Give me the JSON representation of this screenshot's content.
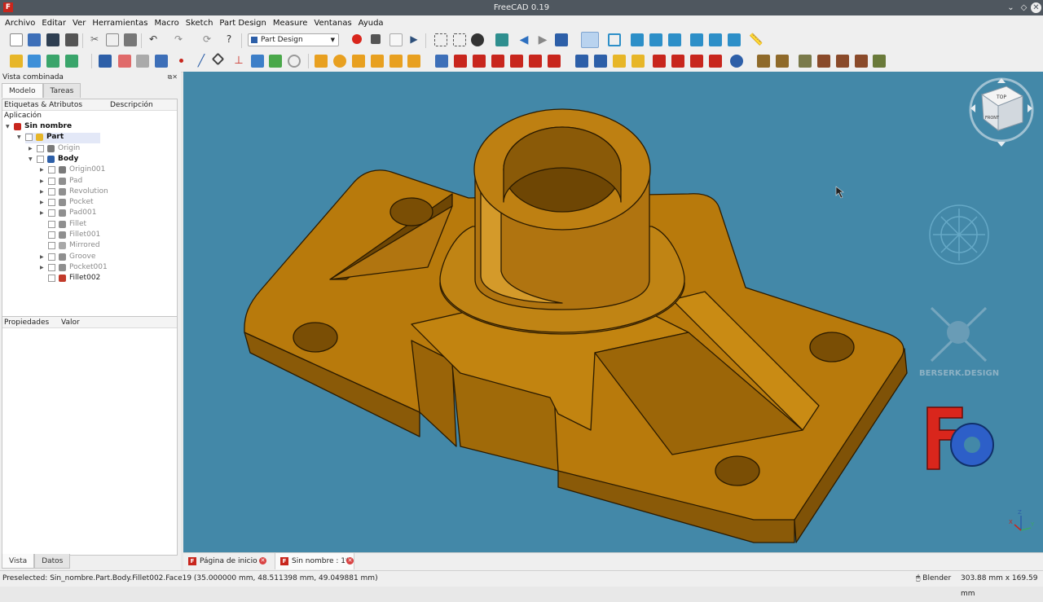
{
  "window": {
    "title": "FreeCAD 0.19"
  },
  "menu": [
    "Archivo",
    "Editar",
    "Ver",
    "Herramientas",
    "Macro",
    "Sketch",
    "Part Design",
    "Measure",
    "Ventanas",
    "Ayuda"
  ],
  "toolbar": {
    "workbench": "Part Design"
  },
  "combo_view": {
    "title": "Vista combinada",
    "tabs": [
      "Modelo",
      "Tareas"
    ],
    "tree_columns": [
      "Etiquetas & Atributos",
      "Descripción"
    ],
    "section": "Aplicación",
    "tree": [
      {
        "label": "Sin nombre",
        "depth": 0,
        "expanded": true,
        "style": "bold",
        "icon": "document-icon",
        "color": "#c8261d"
      },
      {
        "label": "Part",
        "depth": 1,
        "expanded": true,
        "style": "bold",
        "icon": "part-icon",
        "color": "#e7b628",
        "selected": true
      },
      {
        "label": "Origin",
        "depth": 2,
        "expanded": false,
        "style": "gray",
        "icon": "origin-icon",
        "color": "#7a7a7a"
      },
      {
        "label": "Body",
        "depth": 2,
        "expanded": true,
        "style": "bold",
        "icon": "body-icon",
        "color": "#2d5fa8"
      },
      {
        "label": "Origin001",
        "depth": 3,
        "expanded": false,
        "style": "gray",
        "icon": "origin-icon",
        "color": "#7a7a7a"
      },
      {
        "label": "Pad",
        "depth": 3,
        "expanded": false,
        "style": "gray",
        "icon": "pad-icon",
        "color": "#8f8f8f"
      },
      {
        "label": "Revolution",
        "depth": 3,
        "expanded": false,
        "style": "gray",
        "icon": "revolution-icon",
        "color": "#8f8f8f"
      },
      {
        "label": "Pocket",
        "depth": 3,
        "expanded": false,
        "style": "gray",
        "icon": "pocket-icon",
        "color": "#8f8f8f"
      },
      {
        "label": "Pad001",
        "depth": 3,
        "expanded": false,
        "style": "gray",
        "icon": "pad-icon",
        "color": "#8f8f8f"
      },
      {
        "label": "Fillet",
        "depth": 3,
        "style": "gray",
        "icon": "fillet-icon",
        "color": "#8f8f8f"
      },
      {
        "label": "Fillet001",
        "depth": 3,
        "style": "gray",
        "icon": "fillet-icon",
        "color": "#8f8f8f"
      },
      {
        "label": "Mirrored",
        "depth": 3,
        "style": "gray",
        "icon": "mirrored-icon",
        "color": "#a8a8a8"
      },
      {
        "label": "Groove",
        "depth": 3,
        "expanded": false,
        "style": "gray",
        "icon": "groove-icon",
        "color": "#8f8f8f"
      },
      {
        "label": "Pocket001",
        "depth": 3,
        "expanded": false,
        "style": "gray",
        "icon": "pocket-icon",
        "color": "#8f8f8f"
      },
      {
        "label": "Fillet002",
        "depth": 3,
        "style": "normal",
        "icon": "fillet-icon",
        "color": "#c23a2a"
      }
    ],
    "property_columns": [
      "Propiedades",
      "Valor"
    ],
    "bottom_tabs": [
      "Vista",
      "Datos"
    ]
  },
  "viewport": {
    "background": "#4388a8",
    "model_color": "#b87a0c",
    "watermark": "BERSERK.DESIGN",
    "navcube": {
      "top": "TOP",
      "front": "FRONT"
    },
    "axis": [
      "Z",
      "Y",
      "X"
    ]
  },
  "document_tabs": [
    "Página de inicio",
    "Sin nombre : 1*"
  ],
  "status": {
    "message": "Preselected: Sin_nombre.Part.Body.Fillet002.Face19 (35.000000 mm, 48.511398 mm, 49.049881 mm)",
    "navigation": "Blender",
    "dimensions": "303.88 mm x 169.59 mm"
  }
}
